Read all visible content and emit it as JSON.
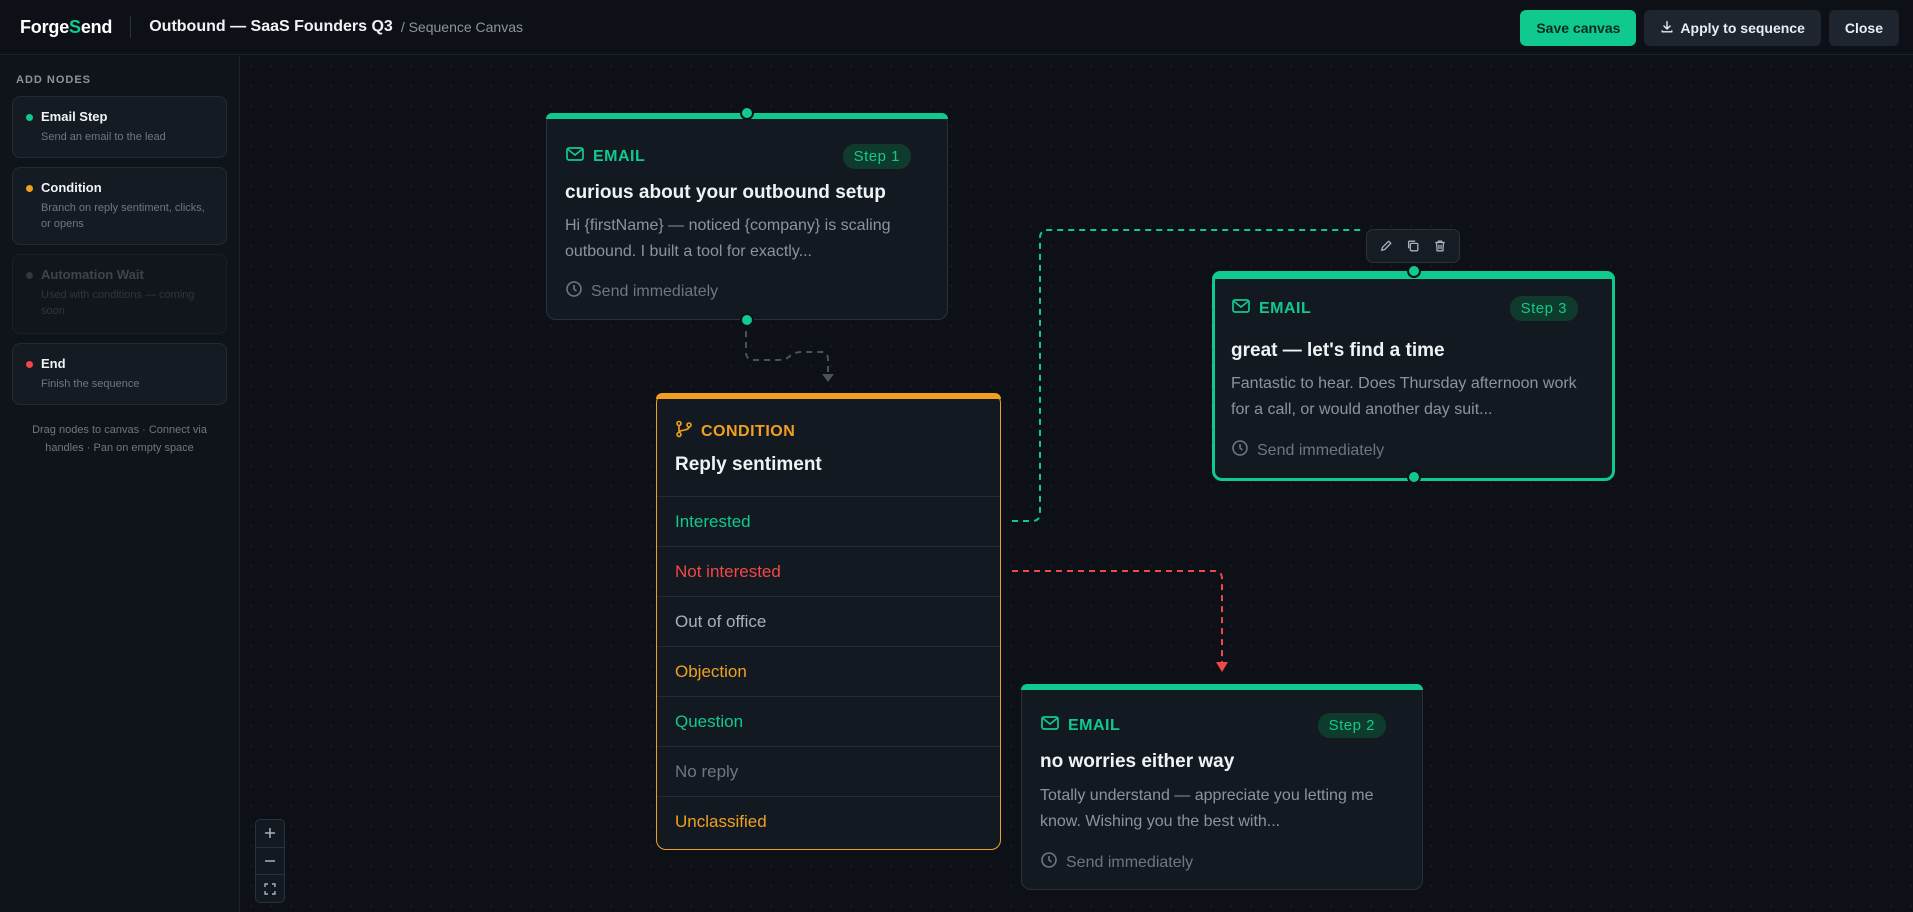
{
  "app": {
    "logo_a": "Forge",
    "logo_b": "S",
    "logo_c": "end",
    "title": "Outbound — SaaS Founders Q3",
    "breadcrumb": "/ Sequence Canvas"
  },
  "actions": {
    "save": "Save canvas",
    "apply": "Apply to sequence",
    "close": "Close"
  },
  "sidebar": {
    "heading": "ADD NODES",
    "items": [
      {
        "name": "Email Step",
        "desc": "Send an email to the lead",
        "color": "#10c98f"
      },
      {
        "name": "Condition",
        "desc": "Branch on reply sentiment, clicks, or opens",
        "color": "#f0a020"
      },
      {
        "name": "Automation Wait",
        "desc": "Used with conditions — coming soon",
        "color": "#3d444d"
      },
      {
        "name": "End",
        "desc": "Finish the sequence",
        "color": "#f04848"
      }
    ],
    "hint": "Drag nodes to canvas · Connect via handles · Pan on empty space"
  },
  "nodes": {
    "step1": {
      "type": "EMAIL",
      "step": "Step 1",
      "title": "curious about your outbound setup",
      "body": "Hi {firstName} — noticed {company} is scaling outbound. I built a tool for exactly...",
      "footer": "Send immediately"
    },
    "step3": {
      "type": "EMAIL",
      "step": "Step 3",
      "title": "great — let's find a time",
      "body": "Fantastic to hear. Does Thursday afternoon work for a call, or would another day suit...",
      "footer": "Send immediately"
    },
    "step2": {
      "type": "EMAIL",
      "step": "Step 2",
      "title": "no worries either way",
      "body": "Totally understand — appreciate you letting me know. Wishing you the best with...",
      "footer": "Send immediately"
    },
    "condition": {
      "type": "CONDITION",
      "title": "Reply sentiment",
      "branches": [
        {
          "label": "Interested",
          "color": "#10c98f"
        },
        {
          "label": "Not interested",
          "color": "#f04848"
        },
        {
          "label": "Out of office",
          "color": "#a8b1bb"
        },
        {
          "label": "Objection",
          "color": "#f0a020"
        },
        {
          "label": "Question",
          "color": "#10c98f"
        },
        {
          "label": "No reply",
          "color": "#6e7681"
        },
        {
          "label": "Unclassified",
          "color": "#f0a020"
        }
      ]
    }
  },
  "colors": {
    "accent": "#10c98f",
    "warn": "#f0a020",
    "danger": "#f04848"
  }
}
